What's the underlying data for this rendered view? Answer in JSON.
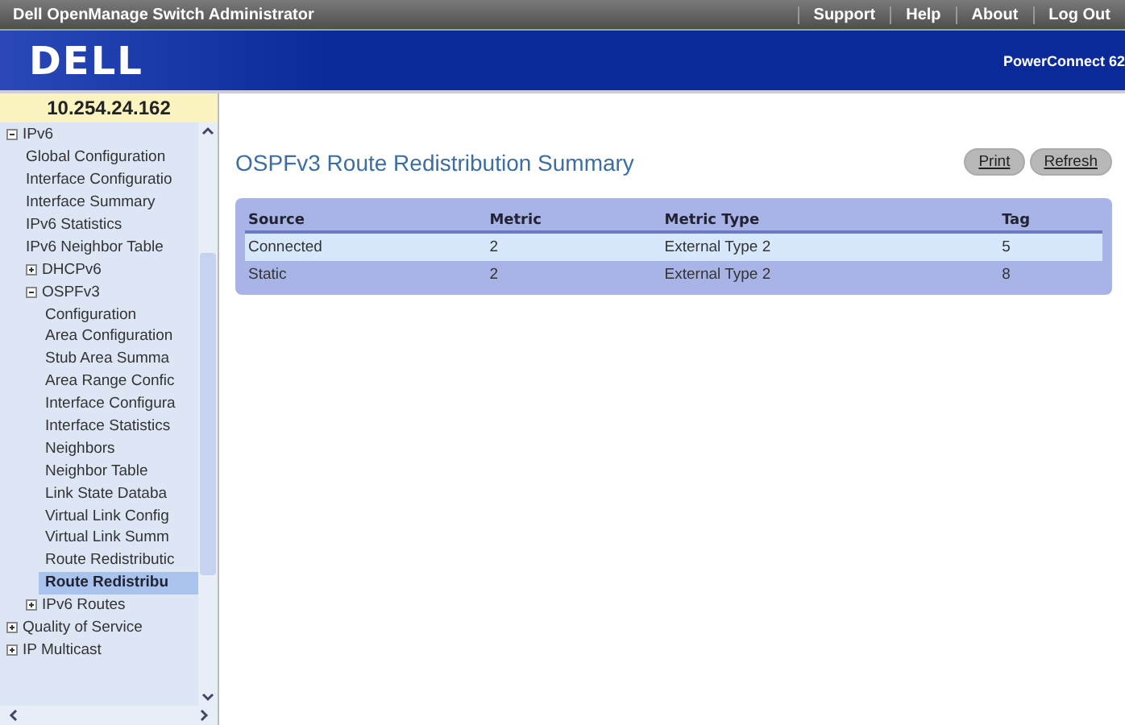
{
  "top_bar": {
    "title": "Dell OpenManage Switch Administrator",
    "links": [
      "Support",
      "Help",
      "About",
      "Log Out"
    ]
  },
  "header": {
    "logo": "DELL",
    "product": "PowerConnect 62"
  },
  "sidebar": {
    "address": "10.254.24.162",
    "tree": [
      {
        "label": "IPv6",
        "expanded": true,
        "selected": false,
        "children": [
          {
            "label": "Global Configuration",
            "selected": false
          },
          {
            "label": "Interface Configuratio",
            "selected": false
          },
          {
            "label": "Interface Summary",
            "selected": false
          },
          {
            "label": "IPv6 Statistics",
            "selected": false
          },
          {
            "label": "IPv6 Neighbor Table",
            "selected": false
          },
          {
            "label": "DHCPv6",
            "expanded": false,
            "selected": false
          },
          {
            "label": "OSPFv3",
            "expanded": true,
            "selected": false,
            "children": [
              {
                "label": "Configuration",
                "selected": false
              },
              {
                "label": "Area Configuration",
                "selected": false
              },
              {
                "label": "Stub Area Summa",
                "selected": false
              },
              {
                "label": "Area Range Confic",
                "selected": false
              },
              {
                "label": "Interface Configura",
                "selected": false
              },
              {
                "label": "Interface Statistics",
                "selected": false
              },
              {
                "label": "Neighbors",
                "selected": false
              },
              {
                "label": "Neighbor Table",
                "selected": false
              },
              {
                "label": "Link State Databa",
                "selected": false
              },
              {
                "label": "Virtual Link Config",
                "selected": false
              },
              {
                "label": "Virtual Link Summ",
                "selected": false
              },
              {
                "label": "Route Redistributic",
                "selected": false
              },
              {
                "label": "Route Redistribu",
                "selected": true
              }
            ]
          },
          {
            "label": "IPv6 Routes",
            "expanded": false,
            "selected": false
          }
        ]
      },
      {
        "label": "Quality of Service",
        "expanded": false,
        "selected": false
      },
      {
        "label": "IP Multicast",
        "expanded": false,
        "selected": false
      }
    ]
  },
  "page": {
    "title": "OSPFv3 Route Redistribution Summary",
    "buttons": [
      "Print",
      "Refresh"
    ],
    "table": {
      "columns": [
        "Source",
        "Metric",
        "Metric Type",
        "Tag"
      ],
      "rows": [
        {
          "cells": [
            "Connected",
            "2",
            "External Type 2",
            "5"
          ],
          "selected": true
        },
        {
          "cells": [
            "Static",
            "2",
            "External Type 2",
            "8"
          ],
          "selected": false
        }
      ]
    }
  }
}
